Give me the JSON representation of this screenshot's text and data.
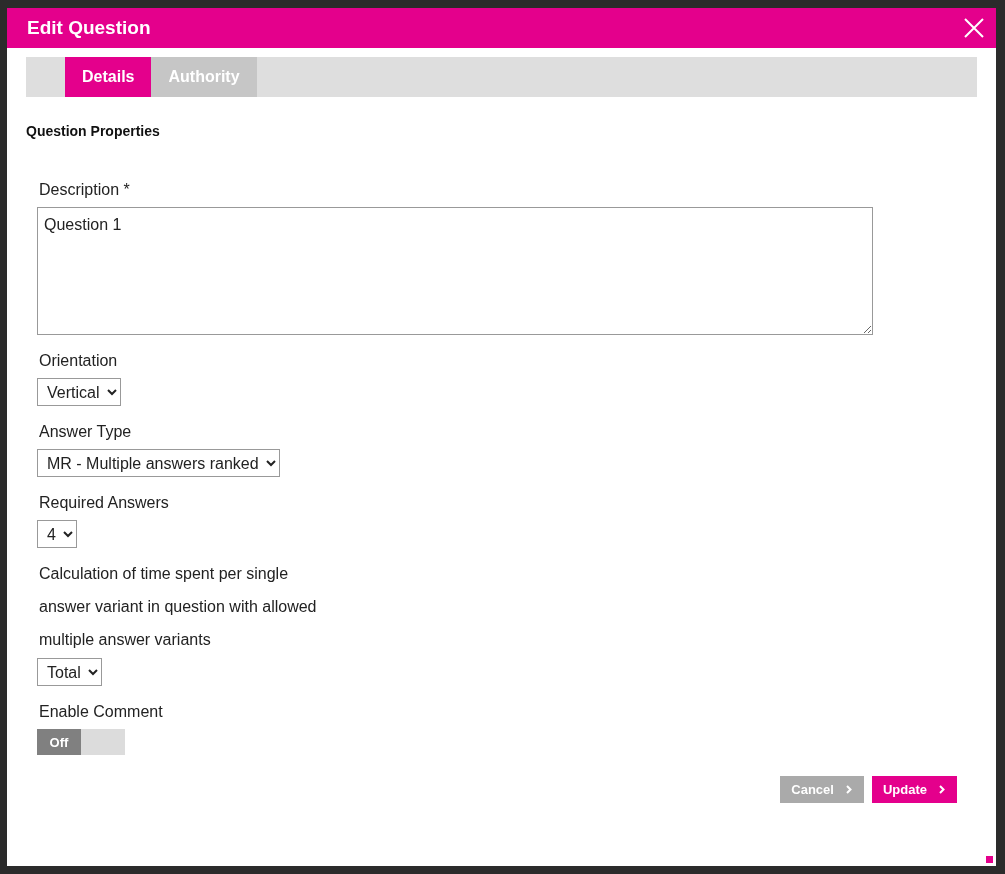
{
  "window": {
    "title": "Edit Question"
  },
  "tabs": [
    {
      "label": "Details",
      "selected": true
    },
    {
      "label": "Authority",
      "selected": false
    }
  ],
  "section_title": "Question Properties",
  "fields": [
    {
      "kind": "textarea",
      "label": "Description *",
      "value": "Question 1"
    },
    {
      "kind": "select",
      "label": "Orientation",
      "value": "Vertical"
    },
    {
      "kind": "select",
      "label": "Answer Type",
      "value": "MR - Multiple answers ranked"
    },
    {
      "kind": "select",
      "label": "Required Answers",
      "value": "4"
    },
    {
      "kind": "select",
      "label": "Calculation of time spent per single answer variant in question with allowed multiple answer variants",
      "value": "Total"
    },
    {
      "kind": "toggle",
      "label": "Enable Comment",
      "on": false,
      "state_label": "Off"
    }
  ],
  "buttons": [
    {
      "kind": "secondary",
      "label": "Cancel"
    },
    {
      "kind": "primary",
      "label": "Update"
    }
  ]
}
